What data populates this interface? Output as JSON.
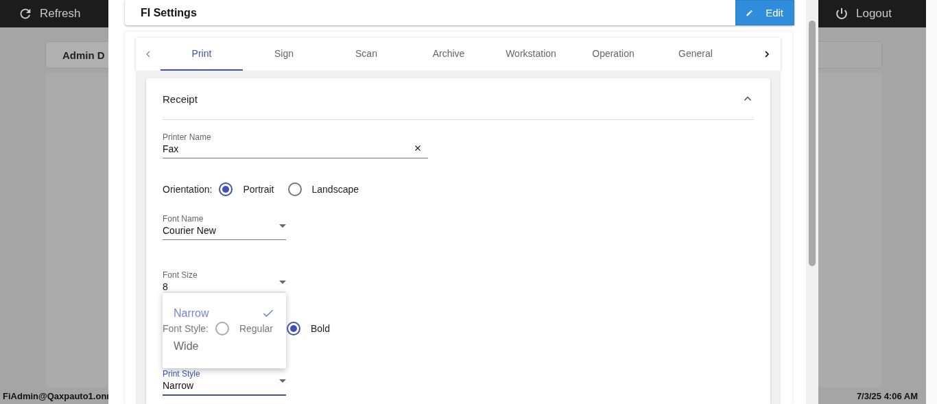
{
  "background": {
    "refresh": "Refresh",
    "logout": "Logout",
    "card_title": "Admin D",
    "user": "FiAdmin@Qaxpauto1.onr",
    "datetime": "7/3/25 4:06 AM"
  },
  "dialog": {
    "title": "FI Settings",
    "edit_button": "Edit",
    "tabs": [
      {
        "label": "Print",
        "selected": true
      },
      {
        "label": "Sign",
        "selected": false
      },
      {
        "label": "Scan",
        "selected": false
      },
      {
        "label": "Archive",
        "selected": false
      },
      {
        "label": "Workstation",
        "selected": false
      },
      {
        "label": "Operation",
        "selected": false
      },
      {
        "label": "General",
        "selected": false
      }
    ],
    "section": {
      "title": "Receipt",
      "expanded": true,
      "printer_name": {
        "label": "Printer Name",
        "value": "Fax"
      },
      "orientation": {
        "label": "Orientation:",
        "options": [
          {
            "label": "Portrait",
            "selected": true
          },
          {
            "label": "Landscape",
            "selected": false
          }
        ]
      },
      "font_name": {
        "label": "Font Name",
        "value": "Courier New"
      },
      "font_size": {
        "label": "Font Size",
        "value": "8"
      },
      "font_style": {
        "label": "Font Style:",
        "options": [
          {
            "label": "Regular",
            "selected": false
          },
          {
            "label": "Bold",
            "selected": true
          }
        ]
      },
      "print_style": {
        "label": "Print Style",
        "value": "Narrow",
        "focused": true,
        "menu": [
          {
            "label": "Narrow",
            "selected": true
          },
          {
            "label": "Wide",
            "selected": false
          }
        ]
      }
    }
  }
}
